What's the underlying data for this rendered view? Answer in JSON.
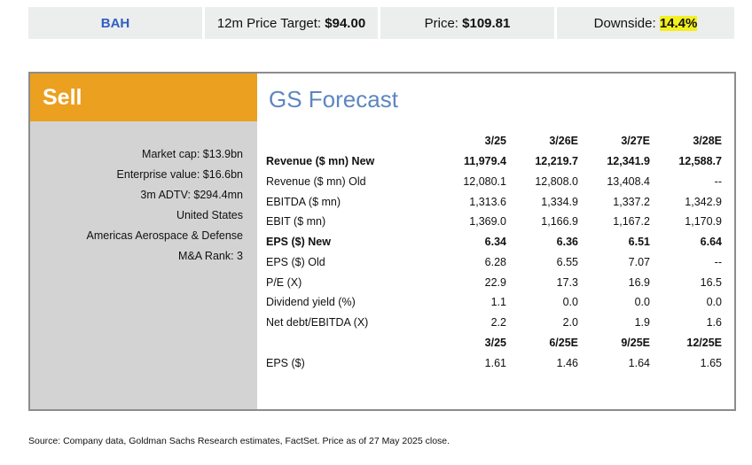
{
  "topbar": {
    "ticker": "BAH",
    "target_label": "12m Price Target:",
    "target_value": "$94.00",
    "price_label": "Price:",
    "price_value": "$109.81",
    "downside_label": "Downside:",
    "downside_value": "14.4%"
  },
  "card": {
    "rating": "Sell",
    "heading": "GS Forecast",
    "meta": [
      "Market cap: $13.9bn",
      "Enterprise value: $16.6bn",
      "3m ADTV: $294.4mn",
      "United States",
      "Americas Aerospace & Defense",
      "M&A Rank: 3"
    ],
    "annual_headers": [
      "3/25",
      "3/26E",
      "3/27E",
      "3/28E"
    ],
    "rows": [
      {
        "label": "Revenue ($ mn) New",
        "values": [
          "11,979.4",
          "12,219.7",
          "12,341.9",
          "12,588.7"
        ]
      },
      {
        "label": "Revenue ($ mn) Old",
        "values": [
          "12,080.1",
          "12,808.0",
          "13,408.4",
          "--"
        ]
      },
      {
        "label": "EBITDA ($ mn)",
        "values": [
          "1,313.6",
          "1,334.9",
          "1,337.2",
          "1,342.9"
        ]
      },
      {
        "label": "EBIT ($ mn)",
        "values": [
          "1,369.0",
          "1,166.9",
          "1,167.2",
          "1,170.9"
        ]
      },
      {
        "label": "EPS ($) New",
        "values": [
          "6.34",
          "6.36",
          "6.51",
          "6.64"
        ]
      },
      {
        "label": "EPS ($) Old",
        "values": [
          "6.28",
          "6.55",
          "7.07",
          "--"
        ]
      },
      {
        "label": "P/E (X)",
        "values": [
          "22.9",
          "17.3",
          "16.9",
          "16.5"
        ]
      },
      {
        "label": "Dividend yield (%)",
        "values": [
          "1.1",
          "0.0",
          "0.0",
          "0.0"
        ]
      },
      {
        "label": "Net debt/EBITDA (X)",
        "values": [
          "2.2",
          "2.0",
          "1.9",
          "1.6"
        ]
      }
    ],
    "quarter_headers": [
      "3/25",
      "6/25E",
      "9/25E",
      "12/25E"
    ],
    "quarter_row": {
      "label": "EPS ($)",
      "values": [
        "1.61",
        "1.46",
        "1.64",
        "1.65"
      ]
    }
  },
  "source": "Source: Company data, Goldman Sachs Research estimates, FactSet. Price as of 27 May 2025 close."
}
